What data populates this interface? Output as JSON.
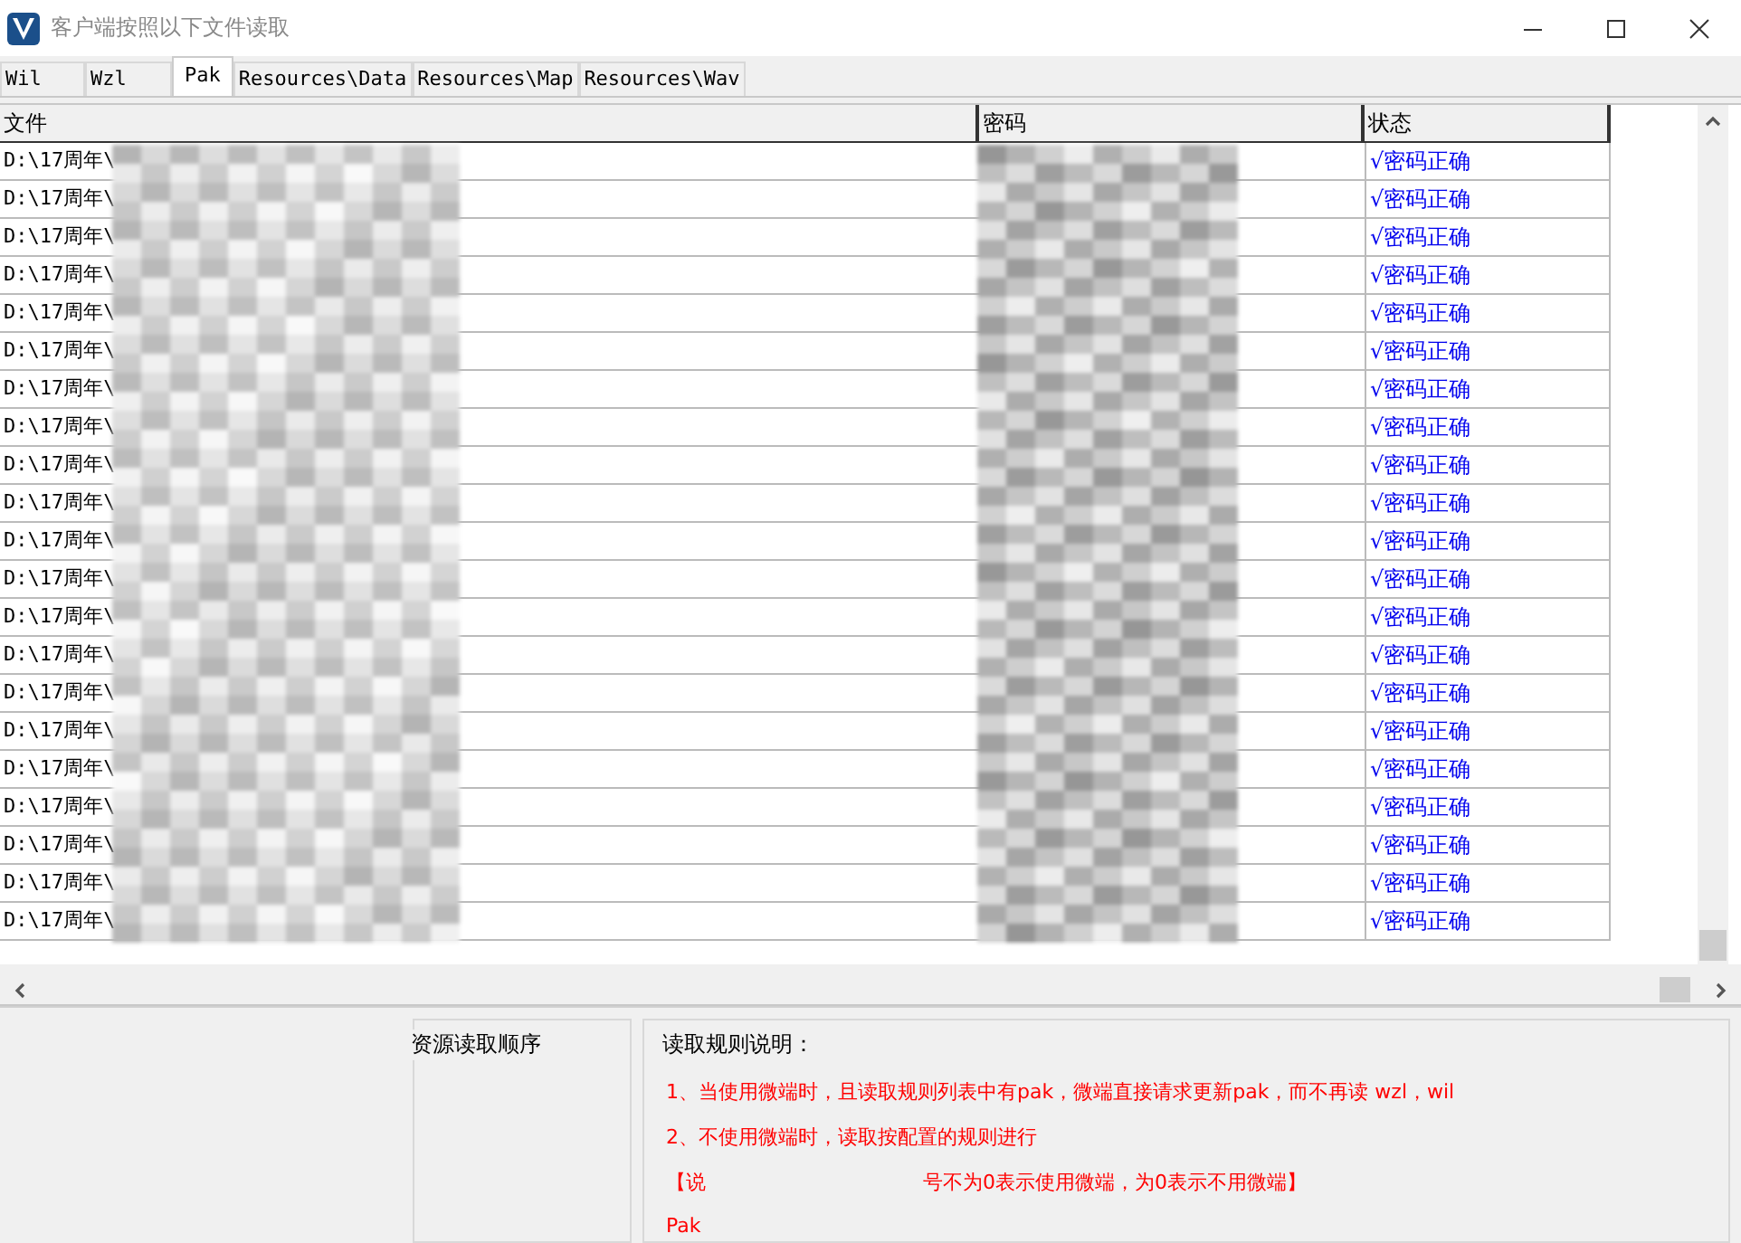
{
  "window": {
    "title": "客户端按照以下文件读取"
  },
  "tabs": [
    {
      "label": "Wil",
      "selected": false
    },
    {
      "label": "Wzl",
      "selected": false
    },
    {
      "label": "Pak",
      "selected": true
    },
    {
      "label": "Resources\\Data",
      "selected": false
    },
    {
      "label": "Resources\\Map",
      "selected": false
    },
    {
      "label": "Resources\\Wav",
      "selected": false
    }
  ],
  "table": {
    "columns": [
      "文件",
      "密码",
      "状态"
    ],
    "rows": [
      {
        "file": "D:\\17周年\\",
        "status": "√密码正确"
      },
      {
        "file": "D:\\17周年\\",
        "status": "√密码正确"
      },
      {
        "file": "D:\\17周年\\",
        "status": "√密码正确"
      },
      {
        "file": "D:\\17周年\\",
        "status": "√密码正确"
      },
      {
        "file": "D:\\17周年\\",
        "status": "√密码正确"
      },
      {
        "file": "D:\\17周年\\",
        "status": "√密码正确"
      },
      {
        "file": "D:\\17周年\\",
        "status": "√密码正确"
      },
      {
        "file": "D:\\17周年\\",
        "status": "√密码正确"
      },
      {
        "file": "D:\\17周年\\",
        "status": "√密码正确"
      },
      {
        "file": "D:\\17周年\\",
        "status": "√密码正确"
      },
      {
        "file": "D:\\17周年\\",
        "status": "√密码正确"
      },
      {
        "file": "D:\\17周年\\",
        "status": "√密码正确"
      },
      {
        "file": "D:\\17周年\\",
        "status": "√密码正确"
      },
      {
        "file": "D:\\17周年\\",
        "status": "√密码正确"
      },
      {
        "file": "D:\\17周年\\",
        "status": "√密码正确"
      },
      {
        "file": "D:\\17周年\\",
        "status": "√密码正确"
      },
      {
        "file": "D:\\17周年\\",
        "status": "√密码正确"
      },
      {
        "file": "D:\\17周年\\",
        "status": "√密码正确"
      },
      {
        "file": "D:\\17周年\\",
        "status": "√密码正确"
      },
      {
        "file": "D:\\17周年\\",
        "status": "√密码正确"
      },
      {
        "file": "D:\\17周年\\",
        "status": "√密码正确"
      }
    ]
  },
  "order_group": {
    "title": "资源读取顺序"
  },
  "rules_group": {
    "title": "读取规则说明：",
    "lines": [
      [
        "1、当使用微端时，且读取规则列表中有pak，微端直接请求更新pak，而不再读 wzl，wil"
      ],
      [
        "2、不使用微端时，读取按配置的规则进行"
      ],
      [
        "【说",
        "号不为0表示使用微端，为0表示不用微端】"
      ],
      [
        "Pak"
      ]
    ]
  }
}
